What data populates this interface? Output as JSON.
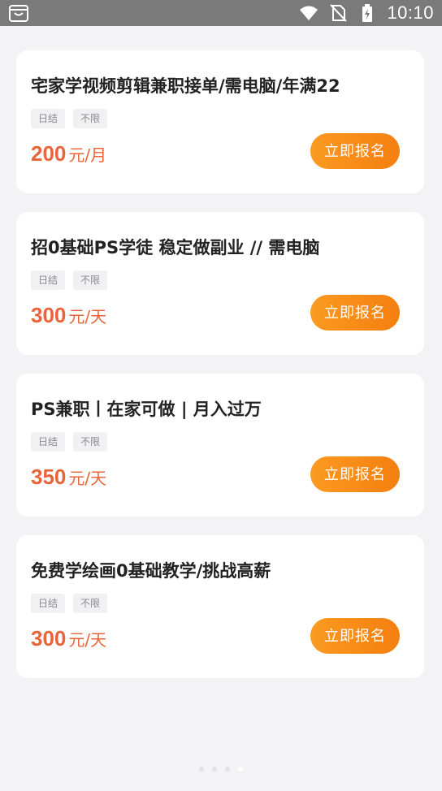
{
  "status_bar": {
    "time": "10:10",
    "left_icon": "shopping-bag-icon",
    "icons": [
      "wifi-icon",
      "no-sim-icon",
      "battery-charging-icon"
    ]
  },
  "jobs": [
    {
      "title": "宅家学视频剪辑兼职接单/需电脑/年满22",
      "tags": [
        "日结",
        "不限"
      ],
      "salary": "200",
      "unit": "元/月",
      "apply_label": "立即报名"
    },
    {
      "title": "招0基础PS学徒 稳定做副业 // 需电脑",
      "tags": [
        "日结",
        "不限"
      ],
      "salary": "300",
      "unit": "元/天",
      "apply_label": "立即报名"
    },
    {
      "title": "PS兼职丨在家可做 | 月入过万",
      "tags": [
        "日结",
        "不限"
      ],
      "salary": "350",
      "unit": "元/天",
      "apply_label": "立即报名"
    },
    {
      "title": "免费学绘画0基础教学/挑战高薪",
      "tags": [
        "日结",
        "不限"
      ],
      "salary": "300",
      "unit": "元/天",
      "apply_label": "立即报名"
    }
  ],
  "pager": {
    "count": 4,
    "active_index": 3
  },
  "colors": {
    "accent": "#f5891a",
    "salary": "#e8643a",
    "status_bar": "#7a7a7a",
    "background": "#f3f3f5"
  }
}
